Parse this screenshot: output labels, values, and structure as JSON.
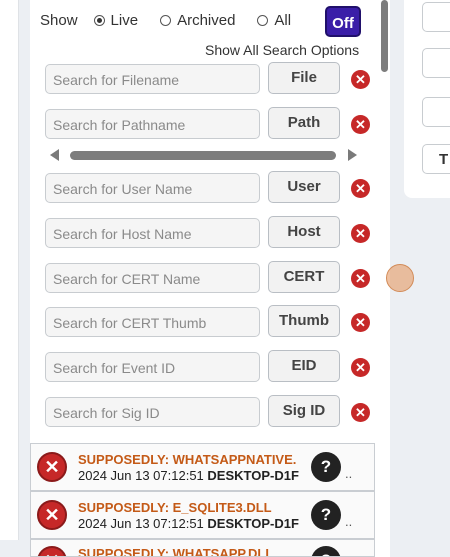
{
  "filter": {
    "show_label": "Show",
    "options": [
      {
        "label": "Live",
        "checked": true
      },
      {
        "label": "Archived",
        "checked": false
      },
      {
        "label": "All",
        "checked": false
      }
    ],
    "toggle_label": "Off",
    "show_all_label": "Show All Search Options"
  },
  "search_fields": [
    {
      "placeholder": "Search for Filename",
      "button": "File"
    },
    {
      "placeholder": "Search for Pathname",
      "button": "Path"
    },
    {
      "placeholder": "Search for User Name",
      "button": "User"
    },
    {
      "placeholder": "Search for Host Name",
      "button": "Host"
    },
    {
      "placeholder": "Search for CERT Name",
      "button": "CERT"
    },
    {
      "placeholder": "Search for CERT Thumb",
      "button": "Thumb"
    },
    {
      "placeholder": "Search for Event ID",
      "button": "EID"
    },
    {
      "placeholder": "Search for Sig ID",
      "button": "Sig ID"
    }
  ],
  "right_panel": {
    "partial_button_label": "T"
  },
  "results": [
    {
      "title": "SUPPOSEDLY: WHATSAPPNATIVE.",
      "timestamp": "2024 Jun 13 07:12:51",
      "host": "DESKTOP-D1F",
      "more": ".."
    },
    {
      "title": "SUPPOSEDLY: E_SQLITE3.DLL",
      "timestamp": "2024 Jun 13 07:12:51",
      "host": "DESKTOP-D1F",
      "more": ".."
    },
    {
      "title": "SUPPOSEDLY: WHATSAPP.DLL"
    }
  ],
  "colors": {
    "accent": "#3a1ea8",
    "danger": "#c62828",
    "result_title": "#c45a17"
  },
  "icons": {
    "remove": "close-circle-icon",
    "help": "question-circle-icon"
  }
}
